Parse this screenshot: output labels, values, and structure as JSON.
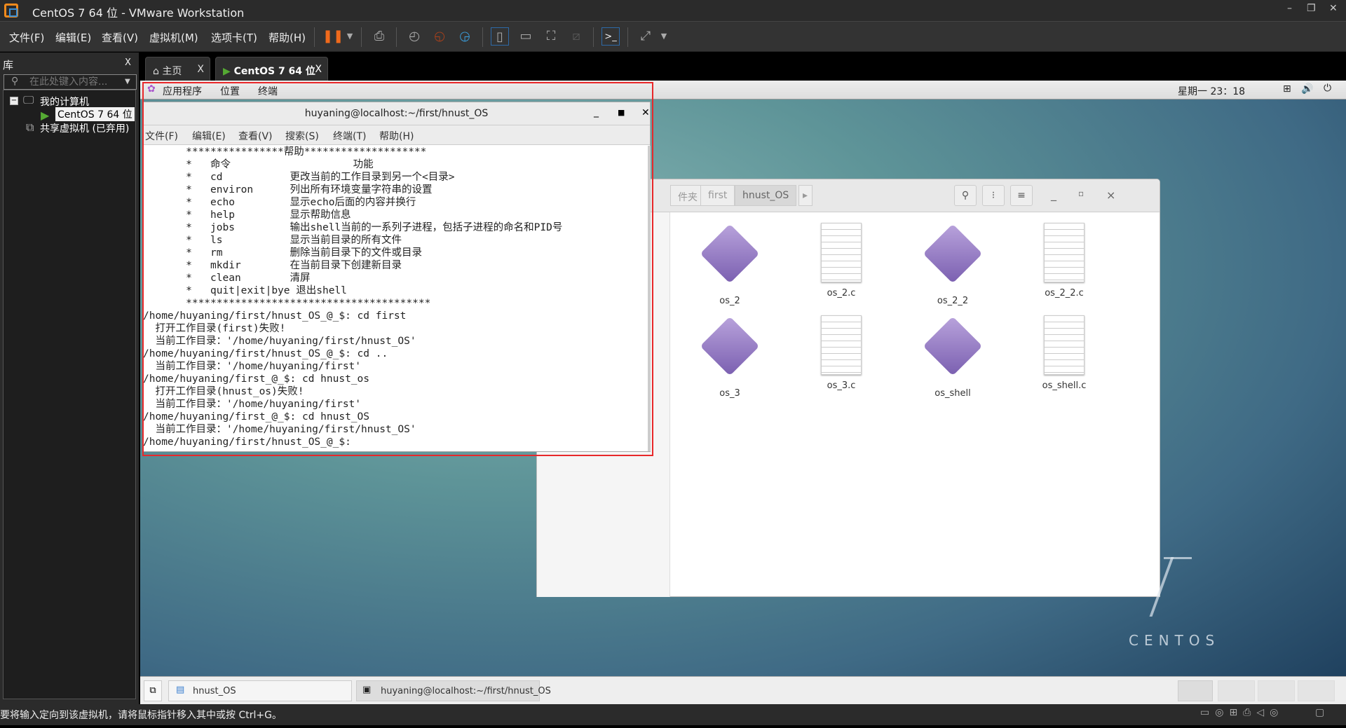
{
  "window": {
    "title": "CentOS 7 64 位 - VMware Workstation",
    "min": "–",
    "restore": "❐",
    "close": "✕"
  },
  "menu": [
    "文件(F)",
    "编辑(E)",
    "查看(V)",
    "虚拟机(M)",
    "选项卡(T)",
    "帮助(H)"
  ],
  "library": {
    "title": "库",
    "close": "X",
    "search_placeholder": "在此处键入内容...",
    "tree": {
      "root": "我的计算机",
      "vm": "CentOS 7 64 位",
      "shared": "共享虚拟机 (已弃用)"
    }
  },
  "tabs": [
    {
      "label": "主页",
      "close": "X"
    },
    {
      "label": "CentOS 7 64 位",
      "close": "X"
    }
  ],
  "gnome": {
    "apps": "应用程序",
    "places": "位置",
    "terminal": "终端",
    "clock": "星期一 23：18"
  },
  "terminal": {
    "title": "huyaning@localhost:~/first/hnust_OS",
    "menu": [
      "文件(F)",
      "编辑(E)",
      "查看(V)",
      "搜索(S)",
      "终端(T)",
      "帮助(H)"
    ],
    "lines": [
      "       ****************帮助********************",
      "       *   命令                    功能",
      "       *   cd           更改当前的工作目录到另一个<目录>",
      "       *   environ      列出所有环境变量字符串的设置",
      "       *   echo         显示echo后面的内容并换行",
      "       *   help         显示帮助信息",
      "       *   jobs         输出shell当前的一系列子进程，包括子进程的命名和PID号",
      "       *   ls           显示当前目录的所有文件",
      "       *   rm           删除当前目录下的文件或目录",
      "       *   mkdir        在当前目录下创建新目录",
      "       *   clean        清屏",
      "       *   quit|exit|bye 退出shell",
      "       ****************************************",
      "/home/huyaning/first/hnust_OS_@_$: cd first",
      "  打开工作目录(first)失败!",
      "  当前工作目录：'/home/huyaning/first/hnust_OS'",
      "/home/huyaning/first/hnust_OS_@_$: cd ..",
      "  当前工作目录：'/home/huyaning/first'",
      "/home/huyaning/first_@_$: cd hnust_os",
      "  打开工作目录(hnust_os)失败!",
      "  当前工作目录：'/home/huyaning/first'",
      "/home/huyaning/first_@_$: cd hnust_OS",
      "  当前工作目录：'/home/huyaning/first/hnust_OS'",
      "/home/huyaning/first/hnust_OS_@_$:"
    ]
  },
  "files": {
    "crumbs": [
      "件夹",
      "first",
      "hnust_OS"
    ],
    "items": [
      {
        "name": "os_2",
        "type": "exe"
      },
      {
        "name": "os_2.c",
        "type": "doc"
      },
      {
        "name": "os_2_2",
        "type": "exe"
      },
      {
        "name": "os_2_2.c",
        "type": "doc"
      },
      {
        "name": "os_3",
        "type": "exe"
      },
      {
        "name": "os_3.c",
        "type": "doc"
      },
      {
        "name": "os_shell",
        "type": "exe"
      },
      {
        "name": "os_shell.c",
        "type": "doc"
      }
    ]
  },
  "brand": "CENTOS",
  "taskbar": [
    "hnust_OS",
    "huyaning@localhost:~/first/hnust_OS"
  ],
  "status": "要将输入定向到该虚拟机，请将鼠标指针移入其中或按 Ctrl+G。",
  "colors": {
    "highlight": "#e8282a",
    "accent": "#f08a1c"
  }
}
